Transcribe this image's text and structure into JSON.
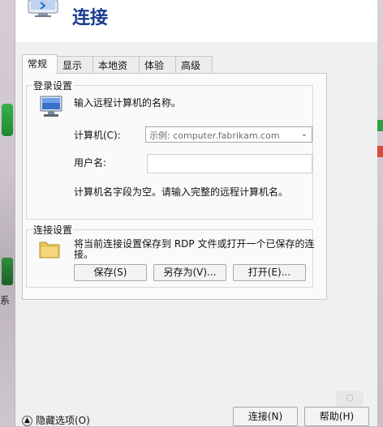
{
  "header": {
    "title": "连接"
  },
  "tabs": [
    {
      "label": "常规"
    },
    {
      "label": "显示"
    },
    {
      "label": "本地资源"
    },
    {
      "label": "体验"
    },
    {
      "label": "高级"
    }
  ],
  "login": {
    "group_label": "登录设置",
    "prompt": "输入远程计算机的名称。",
    "computer_label": "计算机(C):",
    "computer_placeholder": "示例: computer.fabrikam.com",
    "username_label": "用户名:",
    "username_value": "",
    "warning": "计算机名字段为空。请输入完整的远程计算机名。"
  },
  "connection": {
    "group_label": "连接设置",
    "description_line1": "将当前连接设置保存到 RDP 文件或打开一个已保存的连",
    "description_line2": "接。",
    "save_label": "保存(S)",
    "save_as_label": "另存为(V)...",
    "open_label": "打开(E)..."
  },
  "footer": {
    "hide_options_label": "隐藏选项(O)",
    "connect_label": "连接(N)",
    "help_label": "帮助(H)"
  },
  "desktop": {
    "partial_text": "系"
  },
  "colors": {
    "title": "#1a3d8f",
    "dialog_bg": "#f0f0f0",
    "panel_bg": "#fafafa"
  }
}
